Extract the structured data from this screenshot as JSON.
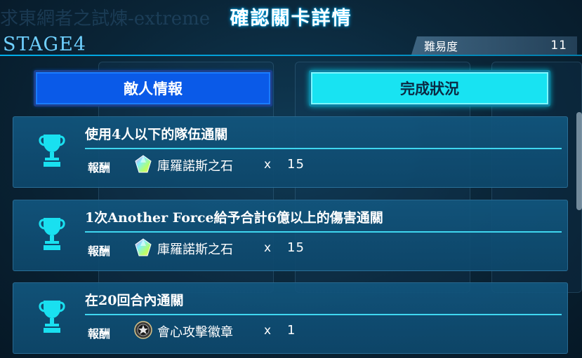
{
  "header": {
    "title": "確認關卡詳情",
    "ghost_title": "求東網者之試煉-extreme",
    "stage_label": "STAGE4",
    "difficulty_label": "難易度",
    "difficulty_value": "11"
  },
  "tabs": [
    {
      "label": "敵人情報",
      "active": false
    },
    {
      "label": "完成狀況",
      "active": true
    }
  ],
  "missions": [
    {
      "title": "使用4人以下的隊伍通關",
      "reward_label": "報酬",
      "reward_icon": "chronos-stone-icon",
      "reward_name": "庫羅諾斯之石",
      "reward_x": "x",
      "reward_qty": "15"
    },
    {
      "title": "1次Another Force給予合計6億以上的傷害通關",
      "reward_label": "報酬",
      "reward_icon": "chronos-stone-icon",
      "reward_name": "庫羅諾斯之石",
      "reward_x": "x",
      "reward_qty": "15"
    },
    {
      "title": "在20回合內通關",
      "reward_label": "報酬",
      "reward_icon": "critical-badge-icon",
      "reward_name": "會心攻擊徽章",
      "reward_x": "x",
      "reward_qty": "1"
    }
  ],
  "colors": {
    "accent_cyan": "#18e3f2",
    "tab_blue": "#0a5ae8",
    "stage_text": "#6fd0ff",
    "trophy": "#19e0f0"
  }
}
